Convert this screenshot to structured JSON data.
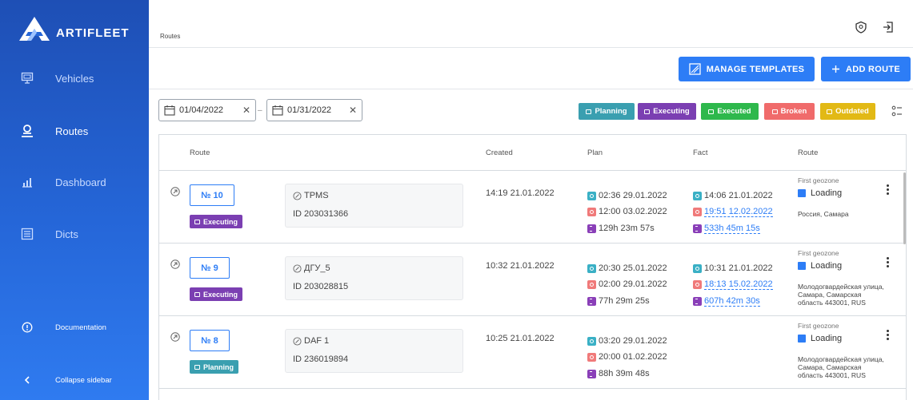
{
  "app": {
    "logo_text": "ARTIFLEET"
  },
  "sidebar": {
    "items": [
      {
        "label": "Vehicles",
        "icon": "vehicles-icon"
      },
      {
        "label": "Routes",
        "icon": "routes-icon",
        "active": true
      },
      {
        "label": "Dashboard",
        "icon": "dashboard-icon"
      },
      {
        "label": "Dicts",
        "icon": "dicts-icon"
      }
    ],
    "documentation": "Documentation",
    "collapse": "Collapse sidebar"
  },
  "header": {
    "breadcrumb": "Routes"
  },
  "toolbar": {
    "manage_templates": "MANAGE TEMPLATES",
    "add_route": "ADD ROUTE"
  },
  "filters": {
    "date_from": "01/04/2022",
    "date_to": "01/31/2022",
    "dash": "–",
    "clear": "✕",
    "statuses": [
      {
        "label": "Planning",
        "color": "#3a9fb0"
      },
      {
        "label": "Executing",
        "color": "#7b3fb2"
      },
      {
        "label": "Executed",
        "color": "#2eb84c"
      },
      {
        "label": "Broken",
        "color": "#f06b6b"
      },
      {
        "label": "Outdated",
        "color": "#e2b915"
      }
    ]
  },
  "table": {
    "columns": [
      "Route",
      "Created",
      "Plan",
      "Fact",
      "Route"
    ],
    "rows": [
      {
        "number": "№ 10",
        "status": "Executing",
        "status_color": "#7b3fb2",
        "vehicle": "TPMS",
        "vehicle_id": "ID 203031366",
        "created": "14:19 21.01.2022",
        "plan_start": "02:36 29.01.2022",
        "plan_end": "12:00 03.02.2022",
        "plan_duration": "129h 23m 57s",
        "fact_start": "14:06 21.01.2022",
        "fact_end": "19:51 12.02.2022",
        "fact_duration": "533h 45m 15s",
        "geo_label": "First geozone",
        "geo_status": "Loading",
        "geo_address": "Россия, Самара"
      },
      {
        "number": "№ 9",
        "status": "Executing",
        "status_color": "#7b3fb2",
        "vehicle": "ДГУ_5",
        "vehicle_id": "ID 203028815",
        "created": "10:32 21.01.2022",
        "plan_start": "20:30 25.01.2022",
        "plan_end": "02:00 29.01.2022",
        "plan_duration": "77h 29m 25s",
        "fact_start": "10:31 21.01.2022",
        "fact_end": "18:13 15.02.2022",
        "fact_duration": "607h 42m 30s",
        "geo_label": "First geozone",
        "geo_status": "Loading",
        "geo_address": "Молодогвардейская улица, Самара, Самарская область 443001, RUS"
      },
      {
        "number": "№ 8",
        "status": "Planning",
        "status_color": "#3a9fb0",
        "vehicle": "DAF 1",
        "vehicle_id": "ID 236019894",
        "created": "10:25 21.01.2022",
        "plan_start": "03:20 29.01.2022",
        "plan_end": "20:00 01.02.2022",
        "plan_duration": "88h 39m 48s",
        "geo_label": "First geozone",
        "geo_status": "Loading",
        "geo_address": "Молодогвардейская улица, Самара, Самарская область 443001, RUS"
      }
    ]
  }
}
